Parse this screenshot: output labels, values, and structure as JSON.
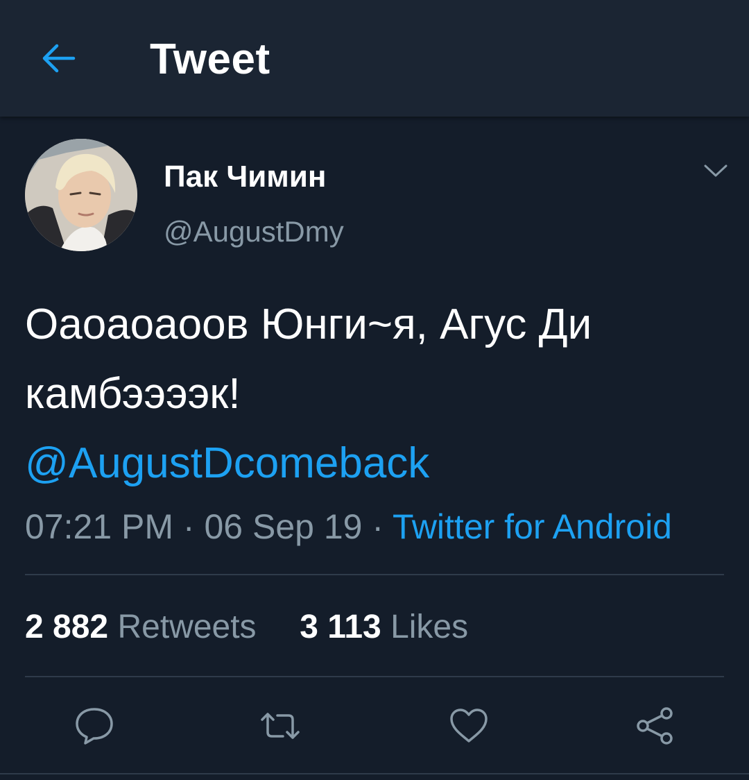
{
  "header": {
    "title": "Tweet",
    "back_icon": "arrow-left-icon"
  },
  "colors": {
    "background": "#141d2a",
    "header_background": "#1b2533",
    "accent": "#1da1f2",
    "secondary_text": "#8899a6"
  },
  "tweet": {
    "author": {
      "display_name": "Пак Чимин",
      "handle": "@AugustDmy"
    },
    "text_line1": "Оаоаоаоов Юнги~я, Агус Ди",
    "text_line2": "камбээээк!",
    "mention": "@AugustDcomeback",
    "time": "07:21 PM",
    "date": "06 Sep 19",
    "separator": "·",
    "source": "Twitter for Android"
  },
  "stats": {
    "retweets_count": "2 882",
    "retweets_label": "Retweets",
    "likes_count": "3 113",
    "likes_label": "Likes"
  },
  "actions": {
    "icons": [
      "reply-icon",
      "retweet-icon",
      "like-icon",
      "share-icon"
    ]
  }
}
